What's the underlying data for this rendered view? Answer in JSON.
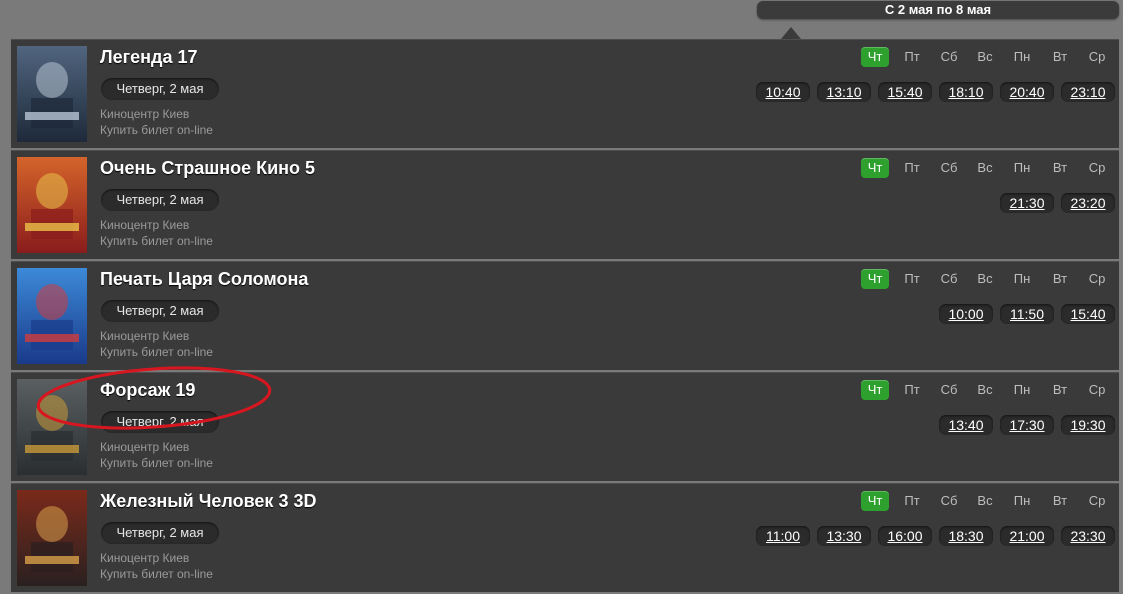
{
  "week": {
    "label": "С 2 мая по 8 мая"
  },
  "days": [
    "Чт",
    "Пт",
    "Сб",
    "Вс",
    "Пн",
    "Вт",
    "Ср"
  ],
  "active_day_color": "#2ea02e",
  "movies": [
    {
      "title": "Легенда 17",
      "date": "Четверг, 2 мая",
      "cinema": "Киноцентр Киев",
      "buy": "Купить билет on-line",
      "times": [
        "10:40",
        "13:10",
        "15:40",
        "18:10",
        "20:40",
        "23:10"
      ]
    },
    {
      "title": "Очень Страшное Кино 5",
      "date": "Четверг, 2 мая",
      "cinema": "Киноцентр Киев",
      "buy": "Купить билет on-line",
      "times": [
        "21:30",
        "23:20"
      ]
    },
    {
      "title": "Печать Царя Соломона",
      "date": "Четверг, 2 мая",
      "cinema": "Киноцентр Киев",
      "buy": "Купить билет on-line",
      "times": [
        "10:00",
        "11:50",
        "15:40"
      ]
    },
    {
      "title": "Форсаж 19",
      "date": "Четверг, 2 мая",
      "cinema": "Киноцентр Киев",
      "buy": "Купить билет on-line",
      "times": [
        "13:40",
        "17:30",
        "19:30"
      ]
    },
    {
      "title": "Железный Человек 3 3D",
      "date": "Четверг, 2 мая",
      "cinema": "Киноцентр Киев",
      "buy": "Купить билет on-line",
      "times": [
        "11:00",
        "13:30",
        "16:00",
        "18:30",
        "21:00",
        "23:30"
      ]
    }
  ]
}
